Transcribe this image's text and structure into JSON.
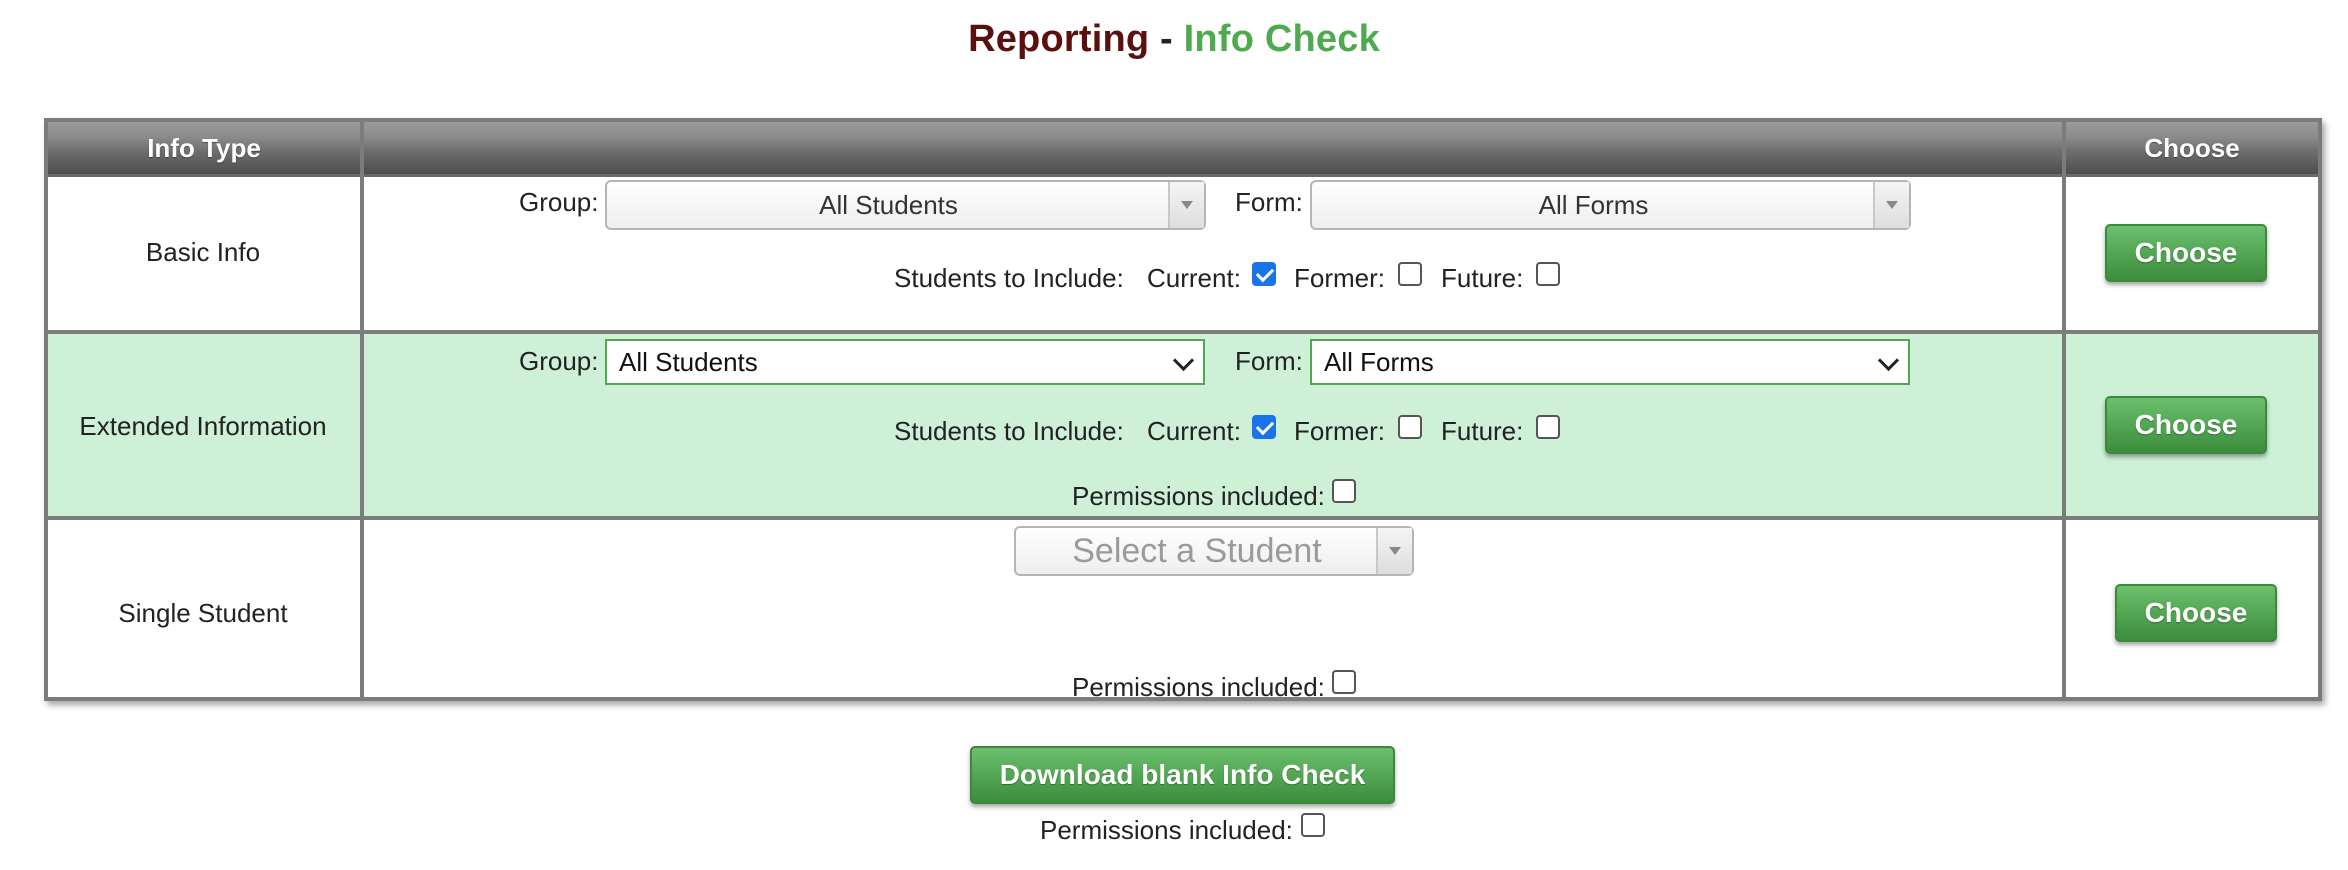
{
  "title": {
    "part1": "Reporting",
    "separator": " - ",
    "part2": "Info Check"
  },
  "table": {
    "headers": {
      "info_type": "Info Type",
      "middle": "",
      "choose": "Choose"
    },
    "rows": [
      {
        "type": "Basic Info",
        "group_label": "Group:",
        "group_value": "All Students",
        "form_label": "Form:",
        "form_value": "All Forms",
        "include_label": "Students to Include:",
        "current_label": "Current:",
        "current_checked": true,
        "former_label": "Former:",
        "former_checked": false,
        "future_label": "Future:",
        "future_checked": false,
        "button_label": "Choose"
      },
      {
        "type": "Extended Information",
        "group_label": "Group:",
        "group_value": "All Students",
        "form_label": "Form:",
        "form_value": "All Forms",
        "include_label": "Students to Include:",
        "current_label": "Current:",
        "current_checked": true,
        "former_label": "Former:",
        "former_checked": false,
        "future_label": "Future:",
        "future_checked": false,
        "permissions_label": "Permissions included:",
        "permissions_checked": false,
        "button_label": "Choose"
      },
      {
        "type": "Single Student",
        "student_placeholder": "Select a Student",
        "permissions_label": "Permissions included:",
        "permissions_checked": false,
        "button_label": "Choose"
      }
    ]
  },
  "download": {
    "button_label": "Download blank Info Check",
    "permissions_label": "Permissions included:",
    "permissions_checked": false
  },
  "colors": {
    "title_dark": "#5b1010",
    "title_green": "#4fa94f",
    "highlight_row": "#cdf0d6",
    "button_green": "#53a653",
    "checkbox_checked": "#1a73e8"
  }
}
